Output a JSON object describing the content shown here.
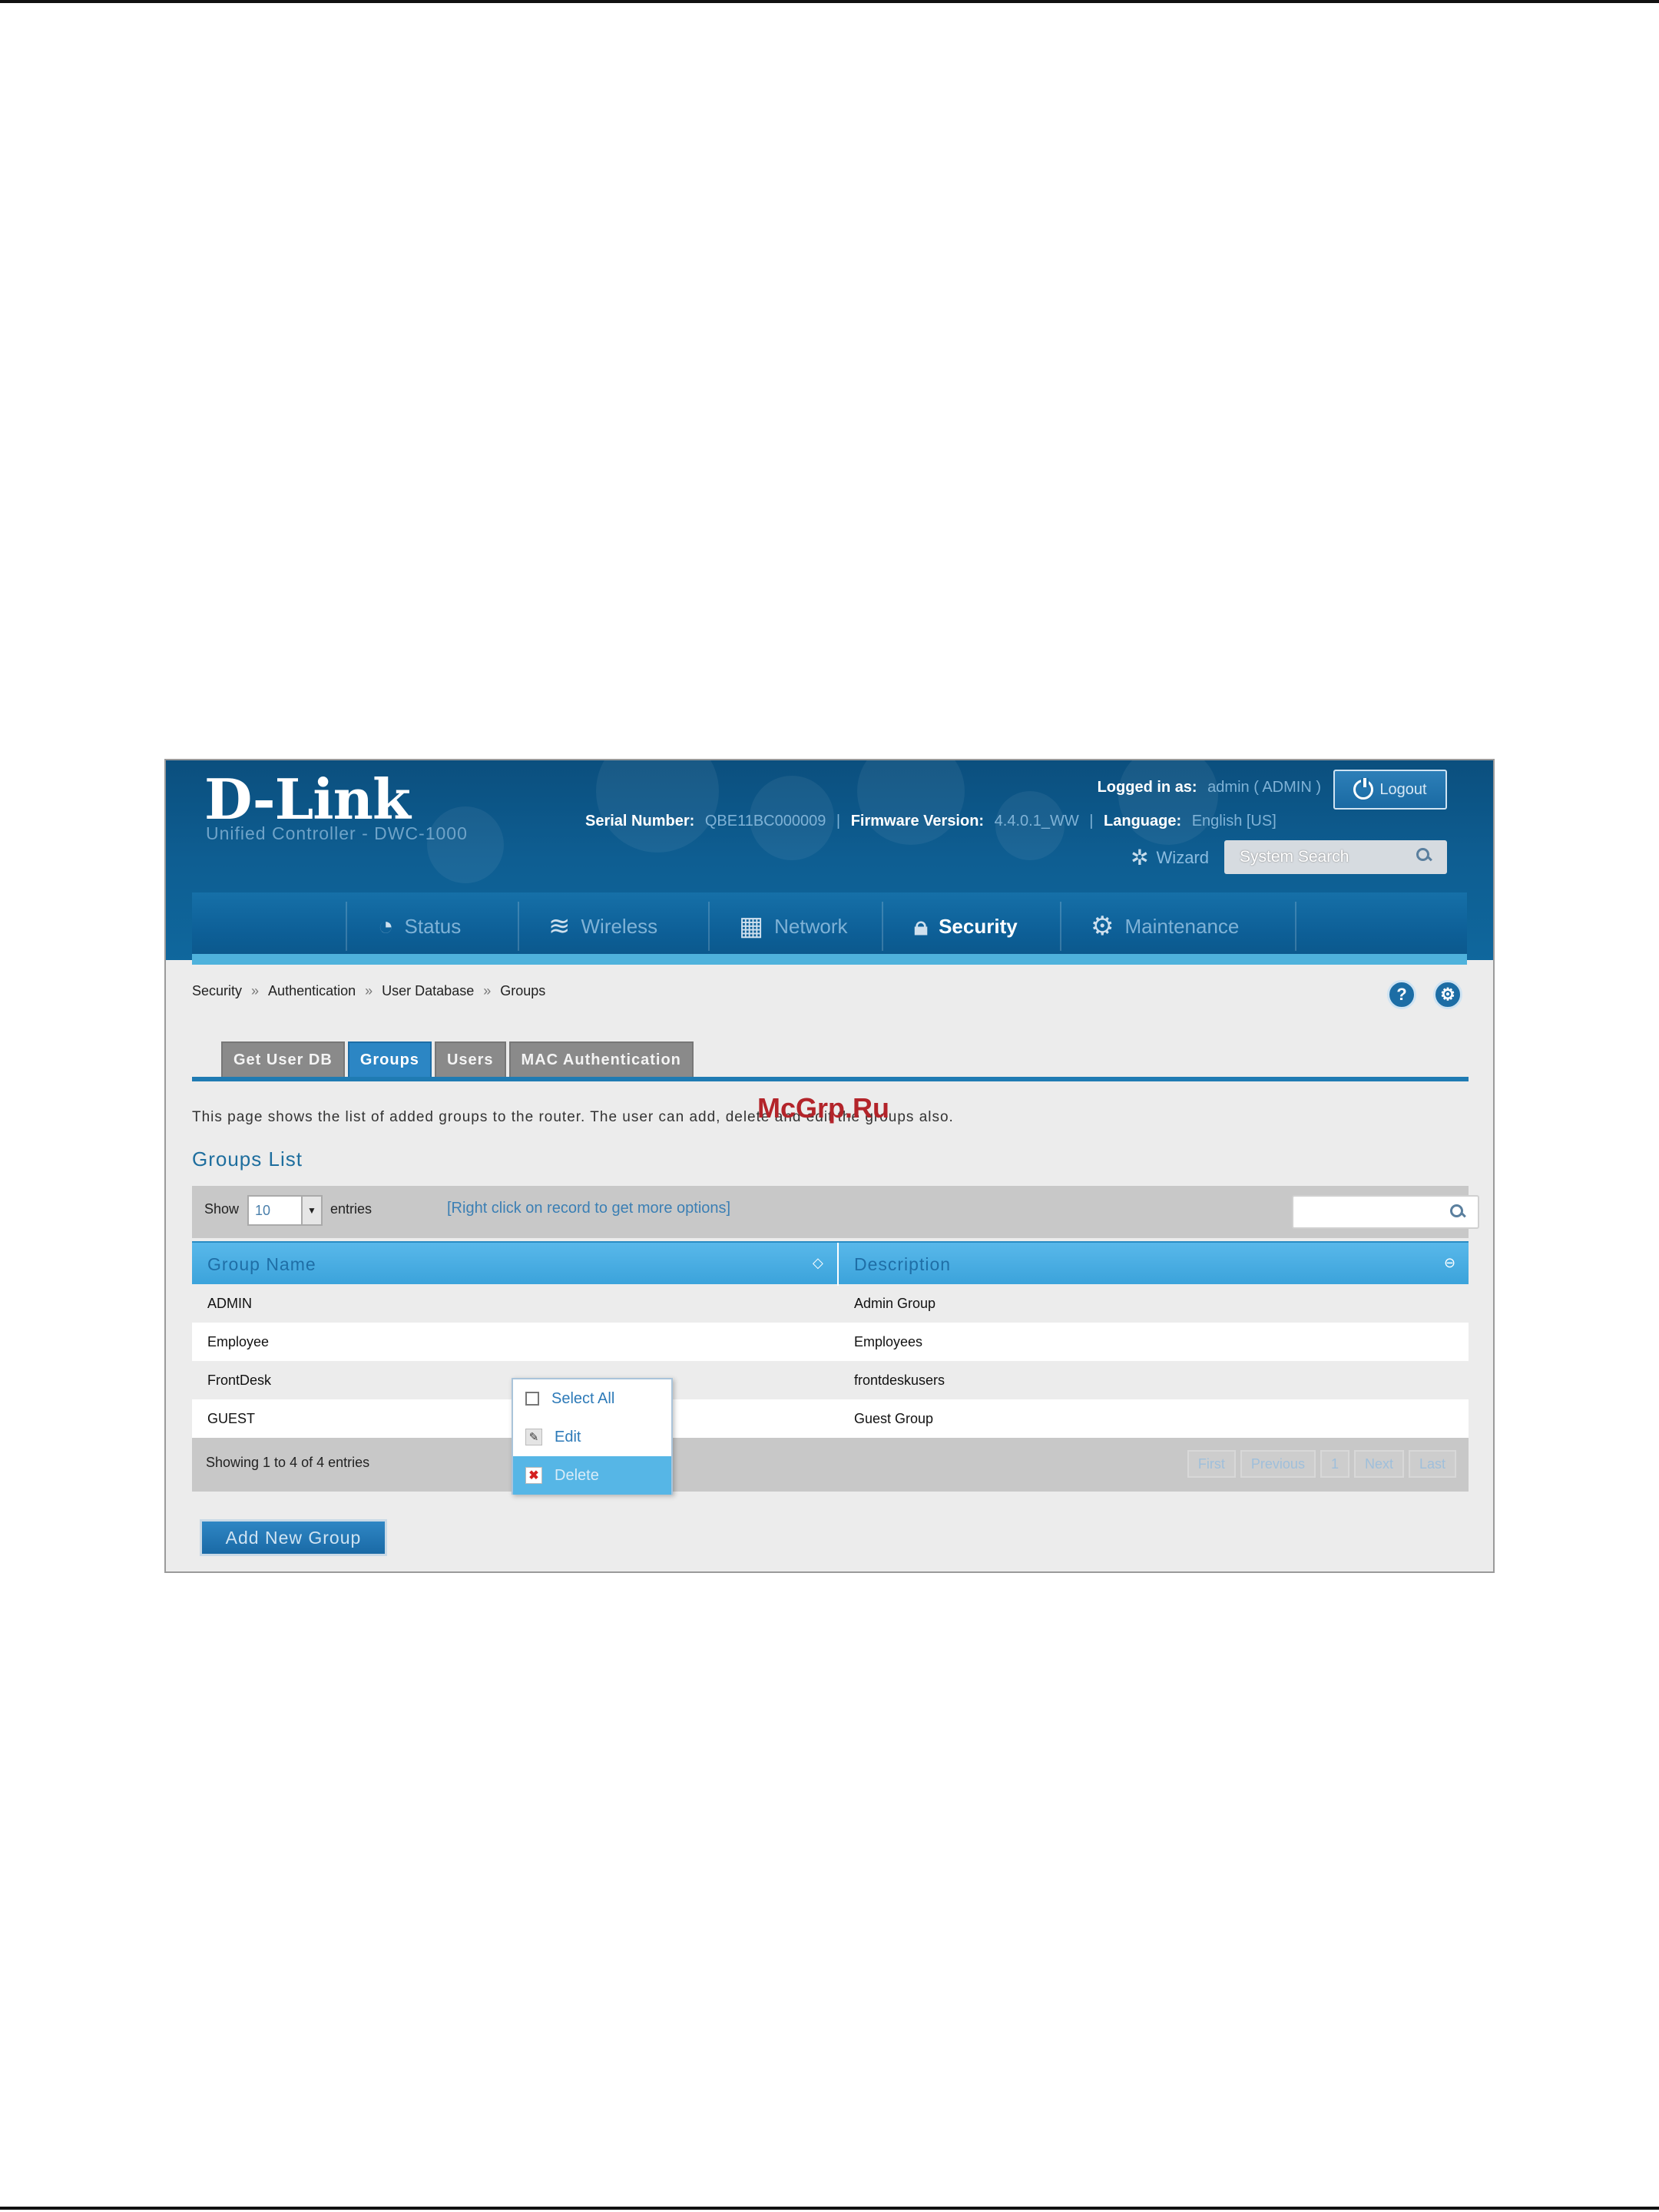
{
  "header": {
    "logo": "D-Link",
    "subtitle": "Unified Controller - DWC-1000",
    "serial_label": "Serial Number:",
    "serial_value": "QBE11BC000009",
    "firmware_label": "Firmware Version:",
    "firmware_value": "4.4.0.1_WW",
    "language_label": "Language:",
    "language_value": "English [US]",
    "logged_label": "Logged in as:",
    "logged_user": "admin",
    "logged_role": "ADMIN",
    "logout_label": "Logout",
    "wizard_label": "Wizard",
    "search_label": "System Search"
  },
  "nav": {
    "items": [
      {
        "label": "Status",
        "icon": "gauge-icon"
      },
      {
        "label": "Wireless",
        "icon": "wifi-icon"
      },
      {
        "label": "Network",
        "icon": "network-icon"
      },
      {
        "label": "Security",
        "icon": "lock-icon"
      },
      {
        "label": "Maintenance",
        "icon": "gears-icon"
      }
    ],
    "active": "Security"
  },
  "breadcrumb": [
    "Security",
    "Authentication",
    "User Database",
    "Groups"
  ],
  "tabs": [
    {
      "label": "Get User DB",
      "active": false
    },
    {
      "label": "Groups",
      "active": true
    },
    {
      "label": "Users",
      "active": false
    },
    {
      "label": "MAC Authentication",
      "active": false
    }
  ],
  "description": "This page shows the list of added groups to the router. The user can add, delete and edit the groups also.",
  "watermark": "McGrp.Ru",
  "section_title": "Groups List",
  "toolbar": {
    "show_label": "Show",
    "show_value": "10",
    "entries_label": "entries",
    "hint": "[Right click on record to get more options]"
  },
  "table": {
    "columns": [
      "Group Name",
      "Description"
    ],
    "rows": [
      [
        "ADMIN",
        "Admin Group"
      ],
      [
        "Employee",
        "Employees"
      ],
      [
        "FrontDesk",
        "frontdeskusers"
      ],
      [
        "GUEST",
        "Guest Group"
      ]
    ]
  },
  "footer": {
    "showing": "Showing 1 to 4 of 4 entries",
    "pager": [
      "First",
      "Previous",
      "1",
      "Next",
      "Last"
    ]
  },
  "add_button": "Add New Group",
  "context_menu": {
    "items": [
      "Select All",
      "Edit",
      "Delete"
    ],
    "highlighted": "Delete"
  },
  "colors": {
    "header_blue": "#0e5e92",
    "accent_blue": "#2c86c4",
    "table_header": "#4aaee2"
  }
}
